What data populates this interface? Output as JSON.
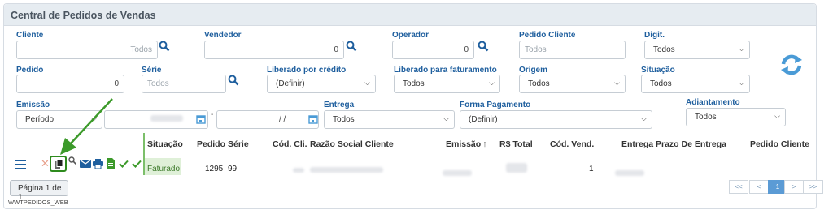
{
  "title": "Central de Pedidos de Vendas",
  "filters": {
    "cliente": {
      "label": "Cliente",
      "placeholder": "Todos"
    },
    "vendedor": {
      "label": "Vendedor",
      "value": "0"
    },
    "operador": {
      "label": "Operador",
      "value": "0"
    },
    "pedido_cliente": {
      "label": "Pedido Cliente",
      "placeholder": "Todos"
    },
    "digit": {
      "label": "Digit.",
      "value": "Todos"
    },
    "pedido": {
      "label": "Pedido",
      "value": "0"
    },
    "serie": {
      "label": "Série",
      "placeholder": "Todos"
    },
    "liberado_credito": {
      "label": "Liberado por crédito",
      "value": "(Definir)"
    },
    "liberado_faturamento": {
      "label": "Liberado para faturamento",
      "value": "Todos"
    },
    "origem": {
      "label": "Origem",
      "value": "Todos"
    },
    "situacao": {
      "label": "Situação",
      "value": "Todos"
    },
    "emissao": {
      "label": "Emissão",
      "value": "Período",
      "date_to": " /  / "
    },
    "entrega": {
      "label": "Entrega",
      "value": "Todos"
    },
    "forma_pagamento": {
      "label": "Forma Pagamento",
      "value": "(Definir)"
    },
    "adiantamento": {
      "label": "Adiantamento",
      "value": "Todos"
    },
    "date_sep": "-"
  },
  "table": {
    "headers": {
      "situacao": "Situação",
      "pedido": "Pedido",
      "serie": "Série",
      "cod_cli": "Cód. Cli.",
      "razao": "Razão Social Cliente",
      "emissao": "Emissão",
      "sort_arrow": "↑",
      "total": "R$ Total",
      "cod_vend": "Cód. Vend.",
      "entrega": "Entrega",
      "prazo": "Prazo De Entrega",
      "pedido_cliente": "Pedido Cliente"
    },
    "row": {
      "situacao": "Faturado",
      "pedido": "1295",
      "serie": "99",
      "cod_vend": "1"
    }
  },
  "pager": {
    "page_label": "Página 1 de 1",
    "first": "<<",
    "prev": "<",
    "current": "1",
    "next": ">",
    "last": ">>"
  },
  "footer_id": "WWTPEDIDOS_WEB",
  "colors": {
    "accent": "#1f5f9e",
    "header_bg": "#e6ecf1",
    "faturado_bg": "#dff0d8",
    "arrow_green": "#3c9a2a",
    "refresh": "#4a9bd6"
  }
}
